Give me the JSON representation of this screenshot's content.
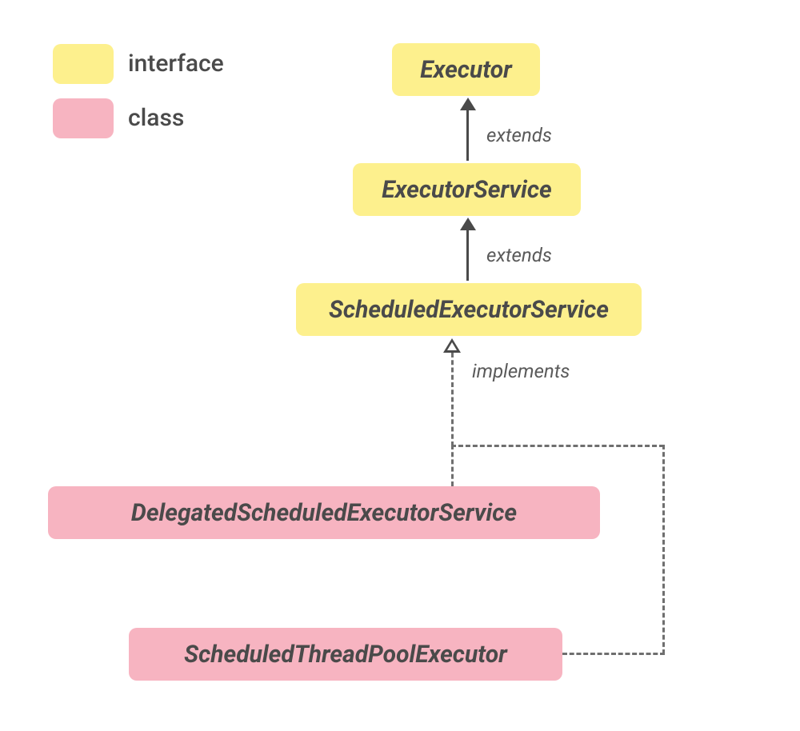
{
  "legend": {
    "items": [
      {
        "label": "interface",
        "color": "#fdf08d"
      },
      {
        "label": "class",
        "color": "#f7b4c1"
      }
    ]
  },
  "nodes": {
    "executor": {
      "label": "Executor",
      "kind": "interface"
    },
    "executorService": {
      "label": "ExecutorService",
      "kind": "interface"
    },
    "scheduledExecutorService": {
      "label": "ScheduledExecutorService",
      "kind": "interface"
    },
    "delegatedScheduledExecutorService": {
      "label": "DelegatedScheduledExecutorService",
      "kind": "class"
    },
    "scheduledThreadPoolExecutor": {
      "label": "ScheduledThreadPoolExecutor",
      "kind": "class"
    }
  },
  "edges": [
    {
      "from": "executorService",
      "to": "executor",
      "label": "extends",
      "kind": "extends"
    },
    {
      "from": "scheduledExecutorService",
      "to": "executorService",
      "label": "extends",
      "kind": "extends"
    },
    {
      "from": "delegatedScheduledExecutorService",
      "to": "scheduledExecutorService",
      "label": "implements",
      "kind": "implements"
    },
    {
      "from": "scheduledThreadPoolExecutor",
      "to": "scheduledExecutorService",
      "label": "implements",
      "kind": "implements"
    }
  ],
  "colors": {
    "interface": "#fdf08d",
    "class": "#f7b4c1",
    "text": "#4a4a4a",
    "line": "#4a4a4a",
    "dash": "#6f6f6f"
  }
}
